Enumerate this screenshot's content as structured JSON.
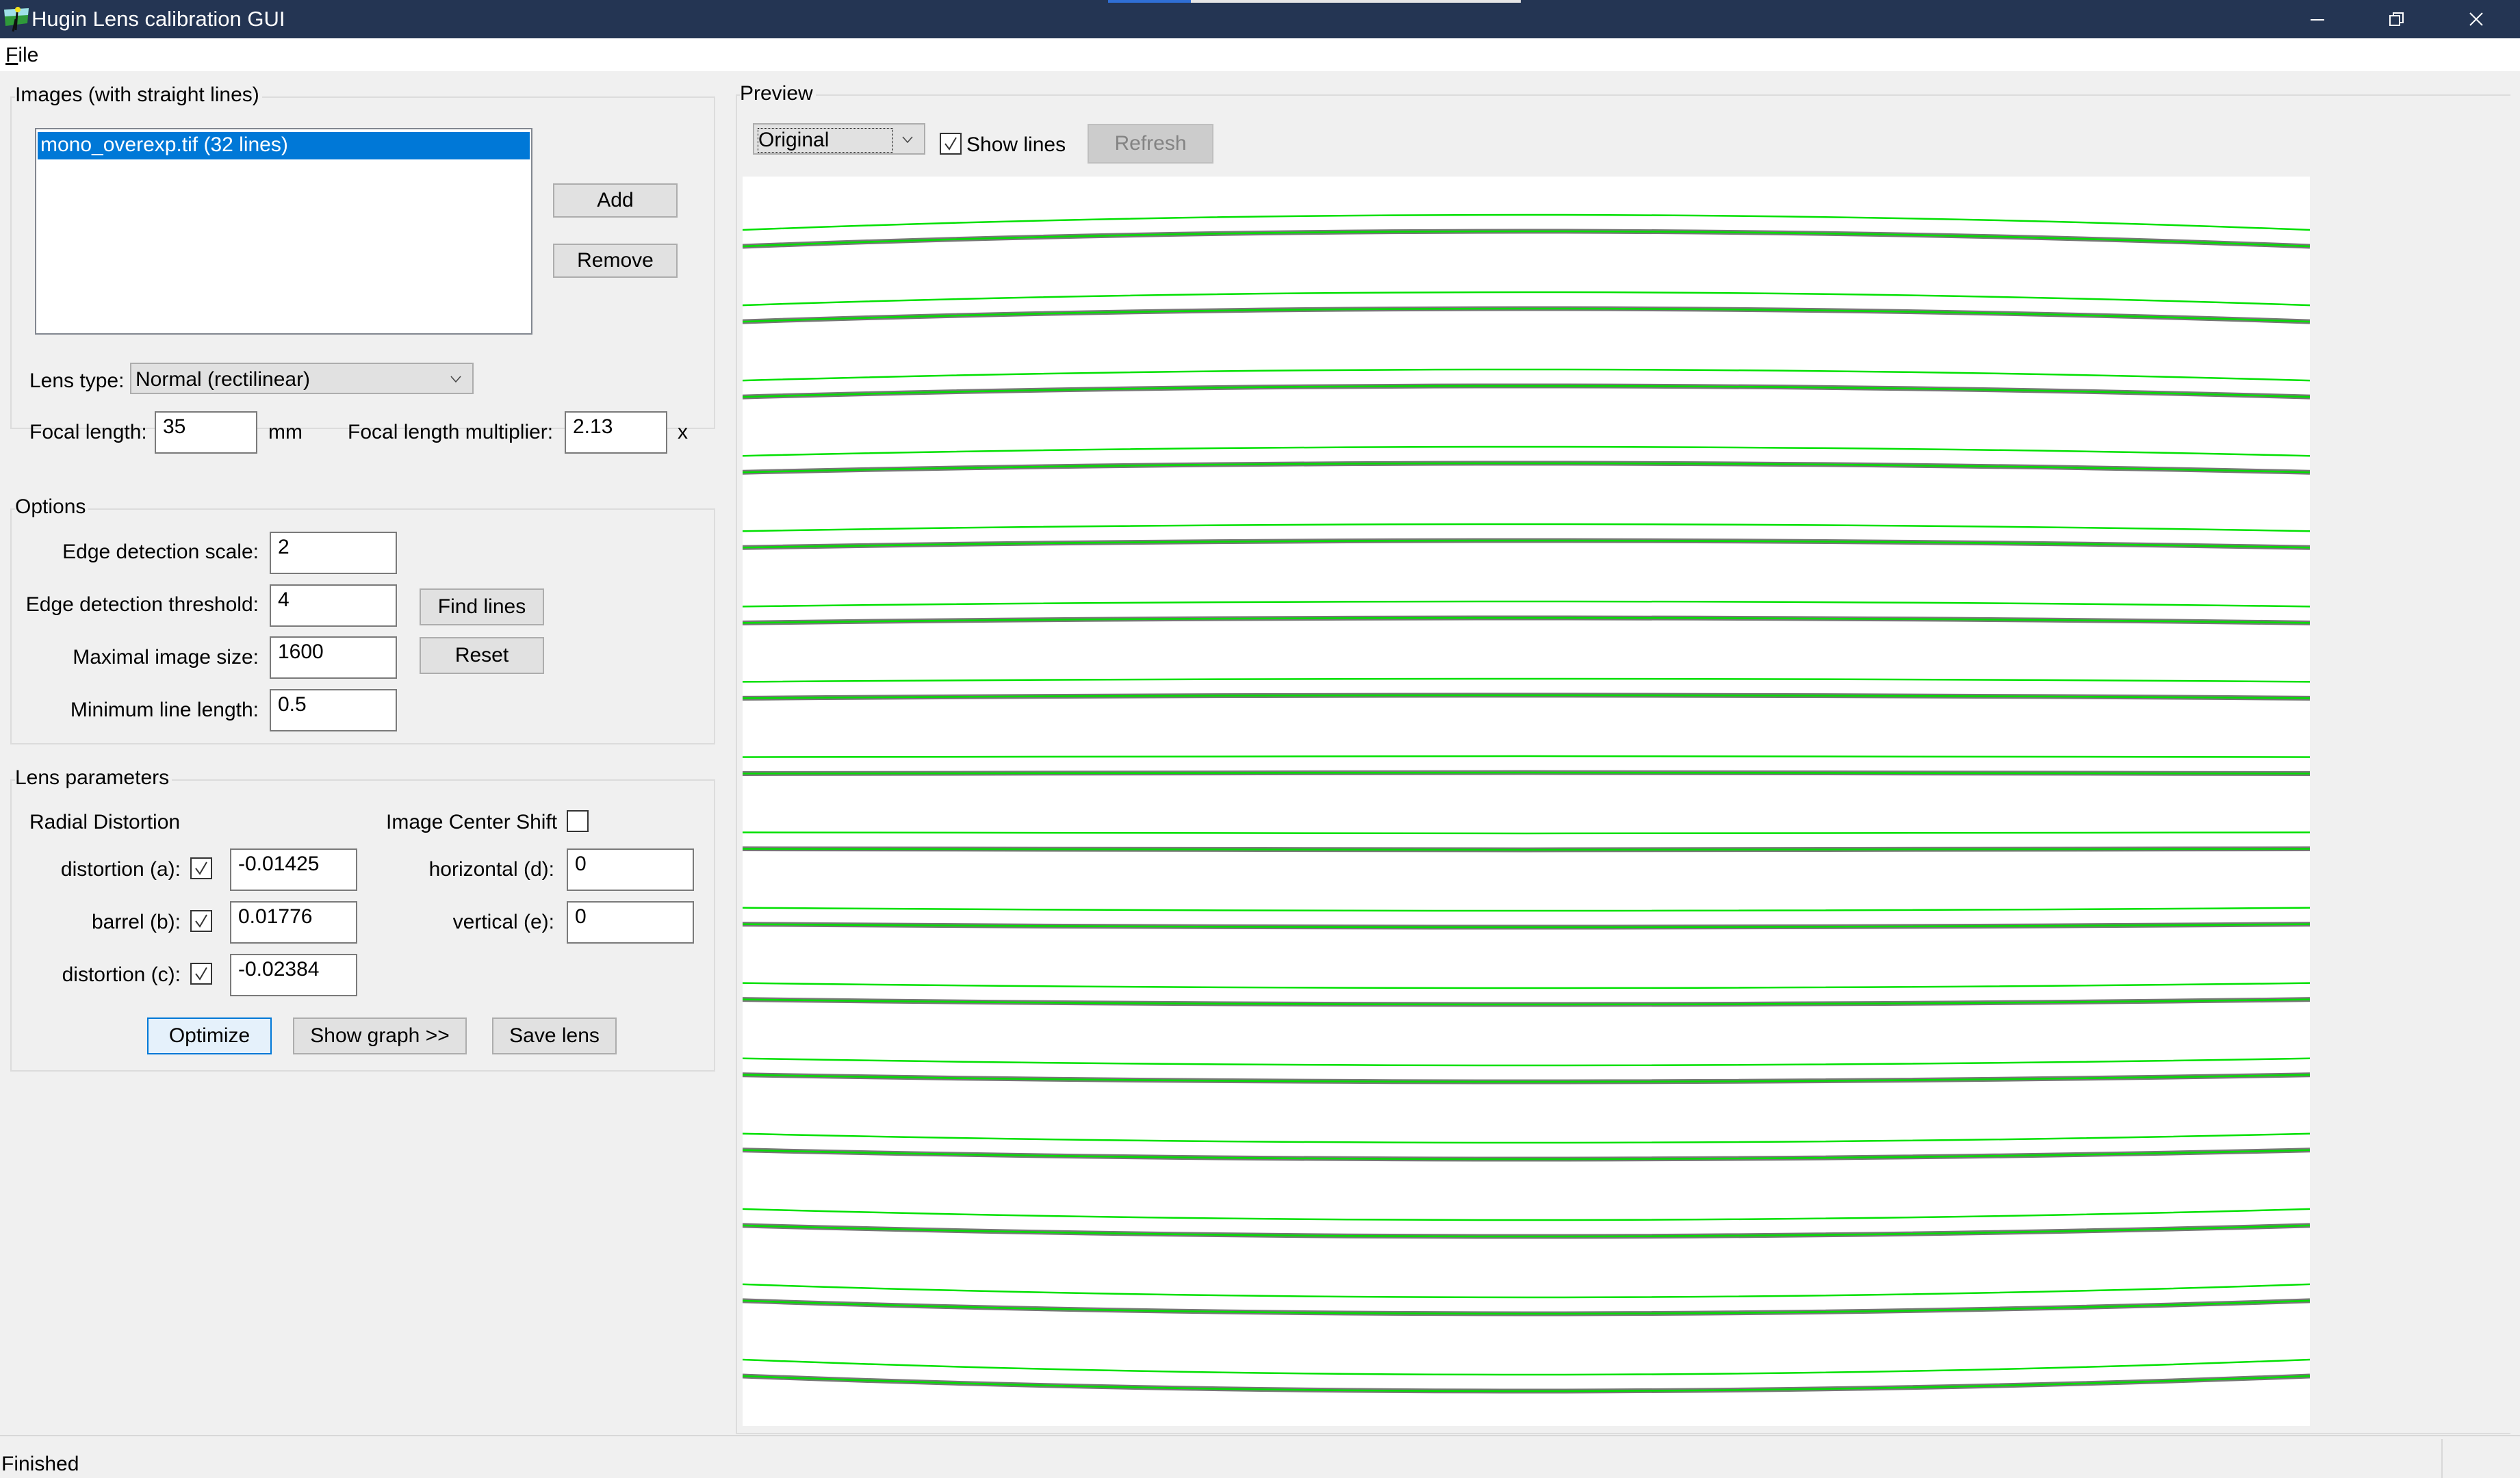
{
  "window": {
    "title": "Hugin Lens calibration GUI",
    "progress_percent": 20,
    "controls": {
      "minimize": "minimize-icon",
      "restore": "restore-icon",
      "close": "close-icon"
    }
  },
  "menu": {
    "file": "File",
    "file_mnemonic": "F",
    "file_rest": "ile"
  },
  "images_group": {
    "label": "Images (with straight lines)",
    "items": [
      "mono_overexp.tif (32 lines)"
    ],
    "selected_index": 0,
    "add_label": "Add",
    "remove_label": "Remove",
    "lens_type_label": "Lens type:",
    "lens_type_value": "Normal (rectilinear)",
    "focal_length_label": "Focal length:",
    "focal_length_value": "35",
    "focal_length_unit": "mm",
    "multiplier_label": "Focal length multiplier:",
    "multiplier_value": "2.13",
    "multiplier_unit": "x"
  },
  "options_group": {
    "label": "Options",
    "edge_scale_label": "Edge detection scale:",
    "edge_scale_value": "2",
    "edge_threshold_label": "Edge detection threshold:",
    "edge_threshold_value": "4",
    "max_size_label": "Maximal image size:",
    "max_size_value": "1600",
    "min_line_label": "Minimum line length:",
    "min_line_value": "0.5",
    "find_lines_label": "Find lines",
    "reset_label": "Reset"
  },
  "lens_group": {
    "label": "Lens parameters",
    "radial_label": "Radial Distortion",
    "center_shift_label": "Image Center Shift",
    "center_shift_checked": false,
    "a_label": "distortion (a):",
    "a_checked": true,
    "a_value": "-0.01425",
    "b_label": "barrel (b):",
    "b_checked": true,
    "b_value": "0.01776",
    "c_label": "distortion (c):",
    "c_checked": true,
    "c_value": "-0.02384",
    "d_label": "horizontal (d):",
    "d_value": "0",
    "e_label": "vertical (e):",
    "e_value": "0",
    "optimize_label": "Optimize",
    "show_graph_label": "Show graph >>",
    "save_lens_label": "Save lens"
  },
  "preview": {
    "label": "Preview",
    "mode_value": "Original",
    "show_lines_label": "Show lines",
    "show_lines_checked": true,
    "refresh_label": "Refresh",
    "line_count": 16,
    "line_color": "#00e000"
  },
  "status": {
    "text": "Finished"
  }
}
